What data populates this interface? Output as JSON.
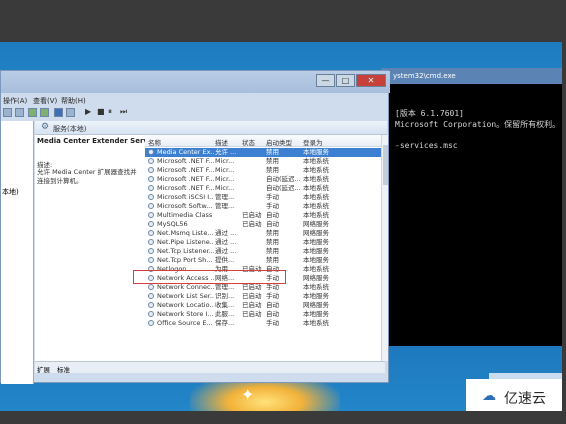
{
  "console": {
    "title": "ystem32\\cmd.exe",
    "lines": [
      "[版本 6.1.7601]",
      "Microsoft Corporation。保留所有权利。",
      "-services.msc"
    ]
  },
  "services_window": {
    "minimize": "—",
    "maximize": "□",
    "close": "✕",
    "menu": [
      "操作(A)",
      "查看(V)",
      "帮助(H)"
    ],
    "left_pane_label": "本地)",
    "header": "服务(本地)",
    "description": {
      "title": "Media Center Extender Service",
      "label": "描述:",
      "text": "允许 Media Center 扩展器查找并连接到计算机。"
    },
    "columns": [
      "名称",
      "描述",
      "状态",
      "启动类型",
      "登录为"
    ],
    "rows": [
      {
        "name": "Media Center Ex...",
        "desc": "允许 ...",
        "status": "",
        "startup": "禁用",
        "logon": "本地服务",
        "selected": true
      },
      {
        "name": "Microsoft .NET F...",
        "desc": "Micr...",
        "status": "",
        "startup": "禁用",
        "logon": "本地系统"
      },
      {
        "name": "Microsoft .NET F...",
        "desc": "Micr...",
        "status": "",
        "startup": "禁用",
        "logon": "本地系统"
      },
      {
        "name": "Microsoft .NET F...",
        "desc": "Micr...",
        "status": "",
        "startup": "自动(延迟...",
        "logon": "本地系统"
      },
      {
        "name": "Microsoft .NET F...",
        "desc": "Micr...",
        "status": "",
        "startup": "自动(延迟...",
        "logon": "本地系统"
      },
      {
        "name": "Microsoft iSCSI I...",
        "desc": "管理...",
        "status": "",
        "startup": "手动",
        "logon": "本地系统"
      },
      {
        "name": "Microsoft Softw...",
        "desc": "管理...",
        "status": "",
        "startup": "手动",
        "logon": "本地系统"
      },
      {
        "name": "Multimedia Class Scheduler",
        "desc": "",
        "status": "已启动",
        "startup": "自动",
        "logon": "本地系统"
      },
      {
        "name": "MySQL56",
        "desc": "",
        "status": "已启动",
        "startup": "自动",
        "logon": "网络服务"
      },
      {
        "name": "Net.Msmq Liste...",
        "desc": "通过 ...",
        "status": "",
        "startup": "禁用",
        "logon": "网络服务"
      },
      {
        "name": "Net.Pipe Listene...",
        "desc": "通过 ...",
        "status": "",
        "startup": "禁用",
        "logon": "本地服务"
      },
      {
        "name": "Net.Tcp Listener...",
        "desc": "通过 ...",
        "status": "",
        "startup": "禁用",
        "logon": "本地服务"
      },
      {
        "name": "Net.Tcp Port Sh...",
        "desc": "提供...",
        "status": "",
        "startup": "禁用",
        "logon": "本地服务"
      },
      {
        "name": "Netlogon",
        "desc": "为用...",
        "status": "已启动",
        "startup": "自动",
        "logon": "本地系统"
      },
      {
        "name": "Network Access ...",
        "desc": "网络...",
        "status": "",
        "startup": "手动",
        "logon": "网络服务"
      },
      {
        "name": "Network Connec...",
        "desc": "管理...",
        "status": "已启动",
        "startup": "手动",
        "logon": "本地系统"
      },
      {
        "name": "Network List Ser...",
        "desc": "识别...",
        "status": "已启动",
        "startup": "手动",
        "logon": "本地服务"
      },
      {
        "name": "Network Locatio...",
        "desc": "收集...",
        "status": "已启动",
        "startup": "自动",
        "logon": "网络服务"
      },
      {
        "name": "Network Store I...",
        "desc": "此服...",
        "status": "已启动",
        "startup": "自动",
        "logon": "本地服务"
      },
      {
        "name": "Office Source E...",
        "desc": "保存...",
        "status": "",
        "startup": "手动",
        "logon": "本地系统"
      }
    ],
    "tabs": [
      "扩展",
      "标准"
    ]
  },
  "watermark": {
    "icon": "cloud-icon",
    "text": "亿速云"
  },
  "colors": {
    "highlight": "#3d7fd0",
    "annotation_red": "#d44040",
    "console_bg": "#000000"
  }
}
